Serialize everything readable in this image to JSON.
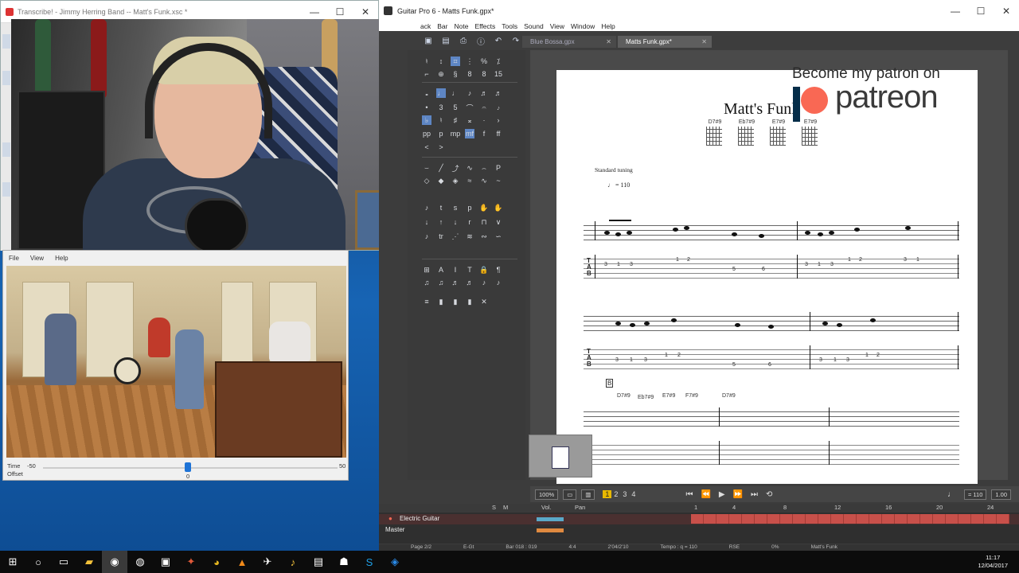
{
  "transcribe": {
    "title": "Transcribe! - Jimmy Herring Band -- Matt's Funk.xsc *",
    "controls": {
      "minimize": "—",
      "maximize": "☐",
      "close": "✕"
    }
  },
  "video_window": {
    "menu": [
      "File",
      "View",
      "Help"
    ],
    "time_label": "Time",
    "time_min": "-50",
    "time_max": "50",
    "offset_label": "Offset",
    "offset_value": "0",
    "slider_value": 0.5
  },
  "guitarpro": {
    "title": "Guitar Pro 6 - Matts Funk.gpx*",
    "menu": [
      "ack",
      "Bar",
      "Note",
      "Effects",
      "Tools",
      "Sound",
      "View",
      "Window",
      "Help"
    ],
    "tabs": [
      {
        "label": "Blue Bossa.gpx",
        "active": false
      },
      {
        "label": "Matts Funk.gpx*",
        "active": true
      }
    ],
    "score": {
      "title": "Matt's Funk",
      "chords": [
        "D7#9",
        "Eb7#9",
        "E7#9",
        "E7#9"
      ],
      "tuning": "Standard tuning",
      "tempo": "♩ = 110",
      "section_b": "B",
      "system3_chords": [
        "D7#9",
        "Eb7#9",
        "E7#9",
        "F7#9",
        "D7#9"
      ],
      "tab_row1": [
        "3",
        "1",
        "3",
        "1",
        "2",
        "5",
        "6",
        "3",
        "1",
        "3",
        "1",
        "2",
        "3",
        "1"
      ],
      "tab_row2": [
        "3",
        "1",
        "3",
        "1",
        "2",
        "5",
        "6",
        "3",
        "1",
        "3",
        "1",
        "2"
      ]
    },
    "patreon": {
      "line1": "Become my patron on",
      "brand": "patreon"
    },
    "transport": {
      "zoom": "100%",
      "bars": [
        "1",
        "2",
        "3",
        "4"
      ],
      "tempo": "= 110",
      "speed": "1.00"
    },
    "tracks": {
      "header_cols": [
        "S",
        "M",
        "Vol.",
        "Pan"
      ],
      "timeline": [
        "1",
        "4",
        "8",
        "12",
        "16",
        "20",
        "24"
      ],
      "rows": [
        {
          "name": "Electric Guitar"
        },
        {
          "name": "Master"
        }
      ]
    },
    "status": [
      "Page 2/2",
      "E-Gt",
      "Bar 018 : 019",
      "4:4",
      "2'04/2'10",
      "Tempo : q = 110",
      "RSE",
      "0%",
      "Matt's Funk"
    ]
  },
  "taskbar": {
    "time": "11:17",
    "date": "12/04/2017"
  },
  "colors": {
    "accent_blue": "#1e73d6",
    "track_red": "#c8504a",
    "patreon_orange": "#f96854"
  }
}
